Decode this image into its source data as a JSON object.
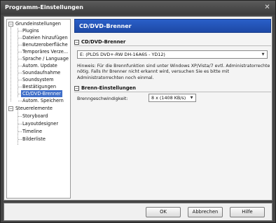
{
  "window": {
    "title": "Programm-Einstellungen",
    "close_symbol": "✕"
  },
  "tree": {
    "groups": [
      {
        "label": "Grundeinstellungen",
        "expander": "−",
        "items": [
          {
            "label": "Plugins"
          },
          {
            "label": "Dateien hinzufügen"
          },
          {
            "label": "Benutzeroberfläche"
          },
          {
            "label": "Temporäres Verze..."
          },
          {
            "label": "Sprache / Language"
          },
          {
            "label": "Autom. Update"
          },
          {
            "label": "Soundaufnahme"
          },
          {
            "label": "Soundsystem"
          },
          {
            "label": "Bestätigungen"
          },
          {
            "label": "CD/DVD-Brenner",
            "selected": true
          },
          {
            "label": "Autom. Speichern"
          }
        ]
      },
      {
        "label": "Steuerelemente",
        "expander": "−",
        "items": [
          {
            "label": "Storyboard"
          },
          {
            "label": "Layoutdesigner"
          },
          {
            "label": "Timeline"
          },
          {
            "label": "Bilderliste"
          }
        ]
      }
    ]
  },
  "content": {
    "header": "CD/DVD-Brenner",
    "section1": {
      "title": "CD/DVD-Brenner",
      "collapse": "−",
      "device_value": "E: (PLDS DVD+-RW DH-16A6S - YD12)",
      "hint": "Hinweis: Für die Brennfunktion sind unter Windows XP/Vista/7 evtl. Administratorrechte nötig. Falls Ihr Brenner nicht erkannt wird, versuchen Sie es bitte mit Administratorrechten noch einmal."
    },
    "section2": {
      "title": "Brenn-Einstellungen",
      "collapse": "−",
      "speed_label": "Brenngeschwindigkeit:",
      "speed_value": "8 x (1408 KB/s)"
    }
  },
  "footer": {
    "ok": "OK",
    "cancel": "Abbrechen",
    "help": "Hilfe"
  },
  "icons": {
    "dropdown_arrow": "▼"
  }
}
